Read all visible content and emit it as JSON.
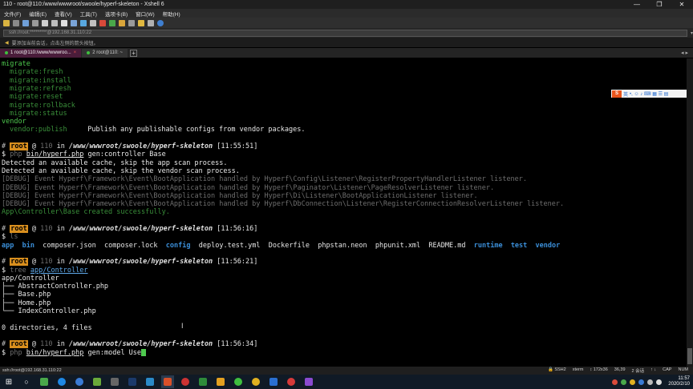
{
  "window": {
    "title": "110 - root@110:/www/wwwroot/swoole/hyperf-skeleton - Xshell 6",
    "minimize": "—",
    "maximize": "❐",
    "close": "✕"
  },
  "menu": [
    "文件(F)",
    "编辑(E)",
    "查看(V)",
    "工具(T)",
    "选项卡(B)",
    "窗口(W)",
    "帮助(H)"
  ],
  "address": {
    "value": "ssh://root:*********@192.168.31.110:22"
  },
  "hint": {
    "text": "要添加当前会话，点击左侧的箭头按钮。"
  },
  "tabs": [
    {
      "label": "1 root@110:/www/wwwroo...",
      "close": "×"
    },
    {
      "label": "2 root@110: ~"
    }
  ],
  "tab_add": "+",
  "tab_nav": "◂ ▸",
  "terminal": {
    "migrate_header": "migrate",
    "migrate_cmds": [
      "migrate:fresh",
      "migrate:install",
      "migrate:refresh",
      "migrate:reset",
      "migrate:rollback",
      "migrate:status"
    ],
    "vendor_header": "vendor",
    "vendor_cmd": "vendor:publish",
    "vendor_desc": "     Publish any publishable configs from vendor packages.",
    "prompts": [
      {
        "host": "110",
        "path": "/www/wwwroot/swoole/hyperf-skeleton",
        "time": "[11:55:51]"
      },
      {
        "host": "110",
        "path": "/www/wwwroot/swoole/hyperf-skeleton",
        "time": "[11:56:16]"
      },
      {
        "host": "110",
        "path": "/www/wwwroot/swoole/hyperf-skeleton",
        "time": "[11:56:21]"
      },
      {
        "host": "110",
        "path": "/www/wwwroot/swoole/hyperf-skeleton",
        "time": "[11:56:34]"
      }
    ],
    "prompt_hash": "#",
    "prompt_user": "root",
    "prompt_at": "@",
    "prompt_in": "in",
    "dollar": "$",
    "cmd1_prog": "php",
    "cmd1_file": "bin/hyperf.php",
    "cmd1_args": " gen:controller Base",
    "out1": [
      "Detected an available cache, skip the app scan process.",
      "Detected an available cache, skip the vendor scan process."
    ],
    "debug": [
      "[DEBUG] Event Hyperf\\Framework\\Event\\BootApplication handled by Hyperf\\Config\\Listener\\RegisterPropertyHandlerListener listener.",
      "[DEBUG] Event Hyperf\\Framework\\Event\\BootApplication handled by Hyperf\\Paginator\\Listener\\PageResolverListener listener.",
      "[DEBUG] Event Hyperf\\Framework\\Event\\BootApplication handled by Hyperf\\Di\\Listener\\BootApplicationListener listener.",
      "[DEBUG] Event Hyperf\\Framework\\Event\\BootApplication handled by Hyperf\\DbConnection\\Listener\\RegisterConnectionResolverListener listener."
    ],
    "created": "App\\Controller\\Base created successfully.",
    "cmd2": "ls",
    "ls": [
      {
        "name": "app",
        "dir": true
      },
      {
        "name": "bin",
        "dir": true
      },
      {
        "name": "composer.json",
        "dir": false
      },
      {
        "name": "composer.lock",
        "dir": false
      },
      {
        "name": "config",
        "dir": true
      },
      {
        "name": "deploy.test.yml",
        "dir": false
      },
      {
        "name": "Dockerfile",
        "dir": false
      },
      {
        "name": "phpstan.neon",
        "dir": false
      },
      {
        "name": "phpunit.xml",
        "dir": false
      },
      {
        "name": "README.md",
        "dir": false
      },
      {
        "name": "runtime",
        "dir": true
      },
      {
        "name": "test",
        "dir": true
      },
      {
        "name": "vendor",
        "dir": true
      }
    ],
    "cmd3_prog": "tree",
    "cmd3_arg": "app/Controller",
    "tree_root": "app/Controller",
    "tree": [
      "├── AbstractController.php",
      "├── Base.php",
      "├── Home.php",
      "└── IndexController.php"
    ],
    "tree_summary": "0 directories, 4 files",
    "cmd4_prog": "php",
    "cmd4_file": "bin/hyperf.php",
    "cmd4_args": " gen:model Use"
  },
  "ime": {
    "logo": "S",
    "label": "英",
    "icons": "•, ☺ ♪ ⌨ ▦ ☰ ▤"
  },
  "status": {
    "left": "ssh://root@192.168.31.110:22",
    "right": [
      "🔒 SSH2",
      "xterm",
      "↕ 172x36",
      "36,39",
      "2 会话",
      "↑ ↓",
      "CAP",
      "NUM"
    ]
  },
  "taskbar": {
    "start": "⊞",
    "search": "○",
    "clock_time": "11:57",
    "clock_date": "2020/2/10"
  },
  "colors": {
    "prompt_tag": "#d98f1e",
    "green": "#4ec94e",
    "dir_blue": "#3b8fd9",
    "active_tab": "#4a1c3a"
  }
}
